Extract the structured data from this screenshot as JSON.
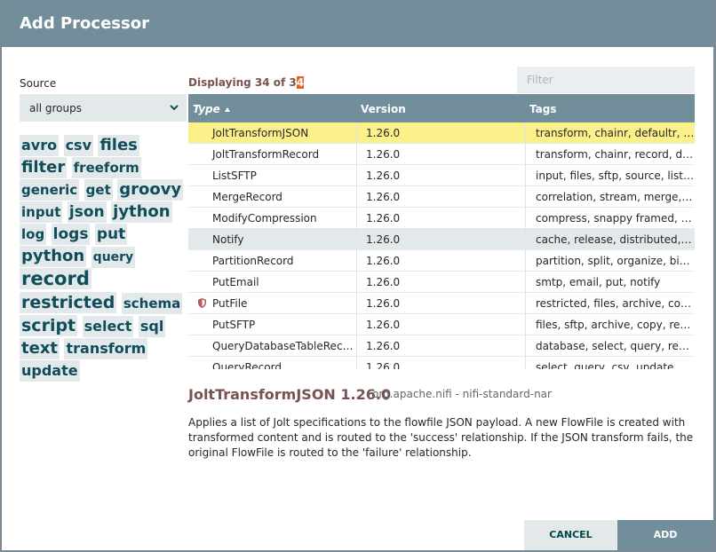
{
  "dialog": {
    "title": "Add Processor"
  },
  "source": {
    "label": "Source",
    "selected": "all groups",
    "icon": "chevron-down-icon"
  },
  "tag_cloud": [
    {
      "text": "avro",
      "size": 16
    },
    {
      "text": "csv",
      "size": 16
    },
    {
      "text": "files",
      "size": 18
    },
    {
      "text": "filter",
      "size": 18
    },
    {
      "text": "freeform",
      "size": 15
    },
    {
      "text": "generic",
      "size": 15
    },
    {
      "text": "get",
      "size": 15
    },
    {
      "text": "groovy",
      "size": 18
    },
    {
      "text": "input",
      "size": 15
    },
    {
      "text": "json",
      "size": 17
    },
    {
      "text": "jython",
      "size": 18
    },
    {
      "text": "log",
      "size": 15
    },
    {
      "text": "logs",
      "size": 17
    },
    {
      "text": "put",
      "size": 17
    },
    {
      "text": "python",
      "size": 18
    },
    {
      "text": "query",
      "size": 14
    },
    {
      "text": "record",
      "size": 21
    },
    {
      "text": "restricted",
      "size": 19
    },
    {
      "text": "schema",
      "size": 15
    },
    {
      "text": "script",
      "size": 19
    },
    {
      "text": "select",
      "size": 16
    },
    {
      "text": "sql",
      "size": 16
    },
    {
      "text": "text",
      "size": 18
    },
    {
      "text": "transform",
      "size": 16
    },
    {
      "text": "update",
      "size": 16
    }
  ],
  "listing": {
    "displaying_prefix": "Displaying 34 of 3",
    "displaying_highlight": "4"
  },
  "filter": {
    "placeholder": "Filter"
  },
  "table": {
    "columns": {
      "type": "Type",
      "version": "Version",
      "tags": "Tags"
    },
    "rows": [
      {
        "type": "JoltTransformJSON",
        "version": "1.26.0",
        "tags": "transform, chainr, defaultr, shiftr, removr",
        "state": "selected",
        "restricted": false
      },
      {
        "type": "JoltTransformRecord",
        "version": "1.26.0",
        "tags": "transform, chainr, record, defaultr, shiftr",
        "state": "",
        "restricted": false
      },
      {
        "type": "ListSFTP",
        "version": "1.26.0",
        "tags": "input, files, sftp, source, list, remote",
        "state": "",
        "restricted": false
      },
      {
        "type": "MergeRecord",
        "version": "1.26.0",
        "tags": "correlation, stream, merge, record, content",
        "state": "",
        "restricted": false
      },
      {
        "type": "ModifyCompression",
        "version": "1.26.0",
        "tags": "compress, snappy framed, brotli, gzip",
        "state": "",
        "restricted": false
      },
      {
        "type": "Notify",
        "version": "1.26.0",
        "tags": "cache, release, distributed, map, notify",
        "state": "hover",
        "restricted": false
      },
      {
        "type": "PartitionRecord",
        "version": "1.26.0",
        "tags": "partition, split, organize, bin, record",
        "state": "",
        "restricted": false
      },
      {
        "type": "PutEmail",
        "version": "1.26.0",
        "tags": "smtp, email, put, notify",
        "state": "",
        "restricted": false
      },
      {
        "type": "PutFile",
        "version": "1.26.0",
        "tags": "restricted, files, archive, copy, put",
        "state": "",
        "restricted": true
      },
      {
        "type": "PutSFTP",
        "version": "1.26.0",
        "tags": "files, sftp, archive, copy, remote, put",
        "state": "",
        "restricted": false
      },
      {
        "type": "QueryDatabaseTableRecord",
        "version": "1.26.0",
        "tags": "database, select, query, record, jdbc",
        "state": "",
        "restricted": false
      },
      {
        "type": "QueryRecord",
        "version": "1.26.0",
        "tags": "select, query, csv, update, calcite",
        "state": "",
        "restricted": false
      }
    ]
  },
  "detail": {
    "title": "JoltTransformJSON 1.26.0",
    "bundle": "org.apache.nifi - nifi-standard-nar",
    "description": "Applies a list of Jolt specifications to the flowfile JSON payload. A new FlowFile is created with transformed content and is routed to the 'success' relationship. If the JSON transform fails, the original FlowFile is routed to the 'failure' relationship."
  },
  "buttons": {
    "cancel": "CANCEL",
    "add": "ADD"
  },
  "colors": {
    "header": "#728e9b",
    "selected_row": "#fcf08b",
    "accent_text": "#775351",
    "tag_text": "#0e4d59",
    "highlight": "#e2622d"
  }
}
